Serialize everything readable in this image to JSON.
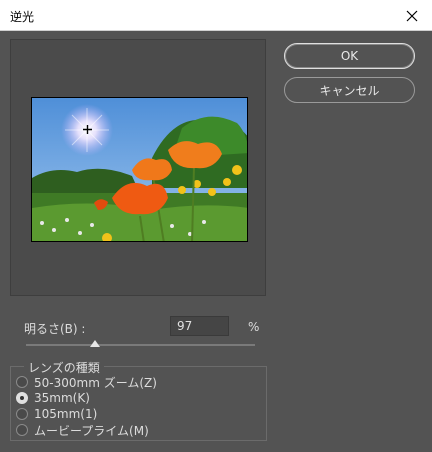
{
  "window": {
    "title": "逆光"
  },
  "buttons": {
    "ok": "OK",
    "cancel": "キャンセル"
  },
  "brightness": {
    "label": "明るさ(B) :",
    "value": "97",
    "unit": "%",
    "level_percent": 97
  },
  "lens": {
    "legend": "レンズの種類",
    "options": [
      {
        "label": "50-300mm ズーム(Z)",
        "checked": false
      },
      {
        "label": "35mm(K)",
        "checked": true
      },
      {
        "label": "105mm(1)",
        "checked": false
      },
      {
        "label": "ムービープライム(M)",
        "checked": false
      }
    ]
  },
  "icons": {
    "close": "close-icon",
    "crosshair": "crosshair-icon"
  }
}
